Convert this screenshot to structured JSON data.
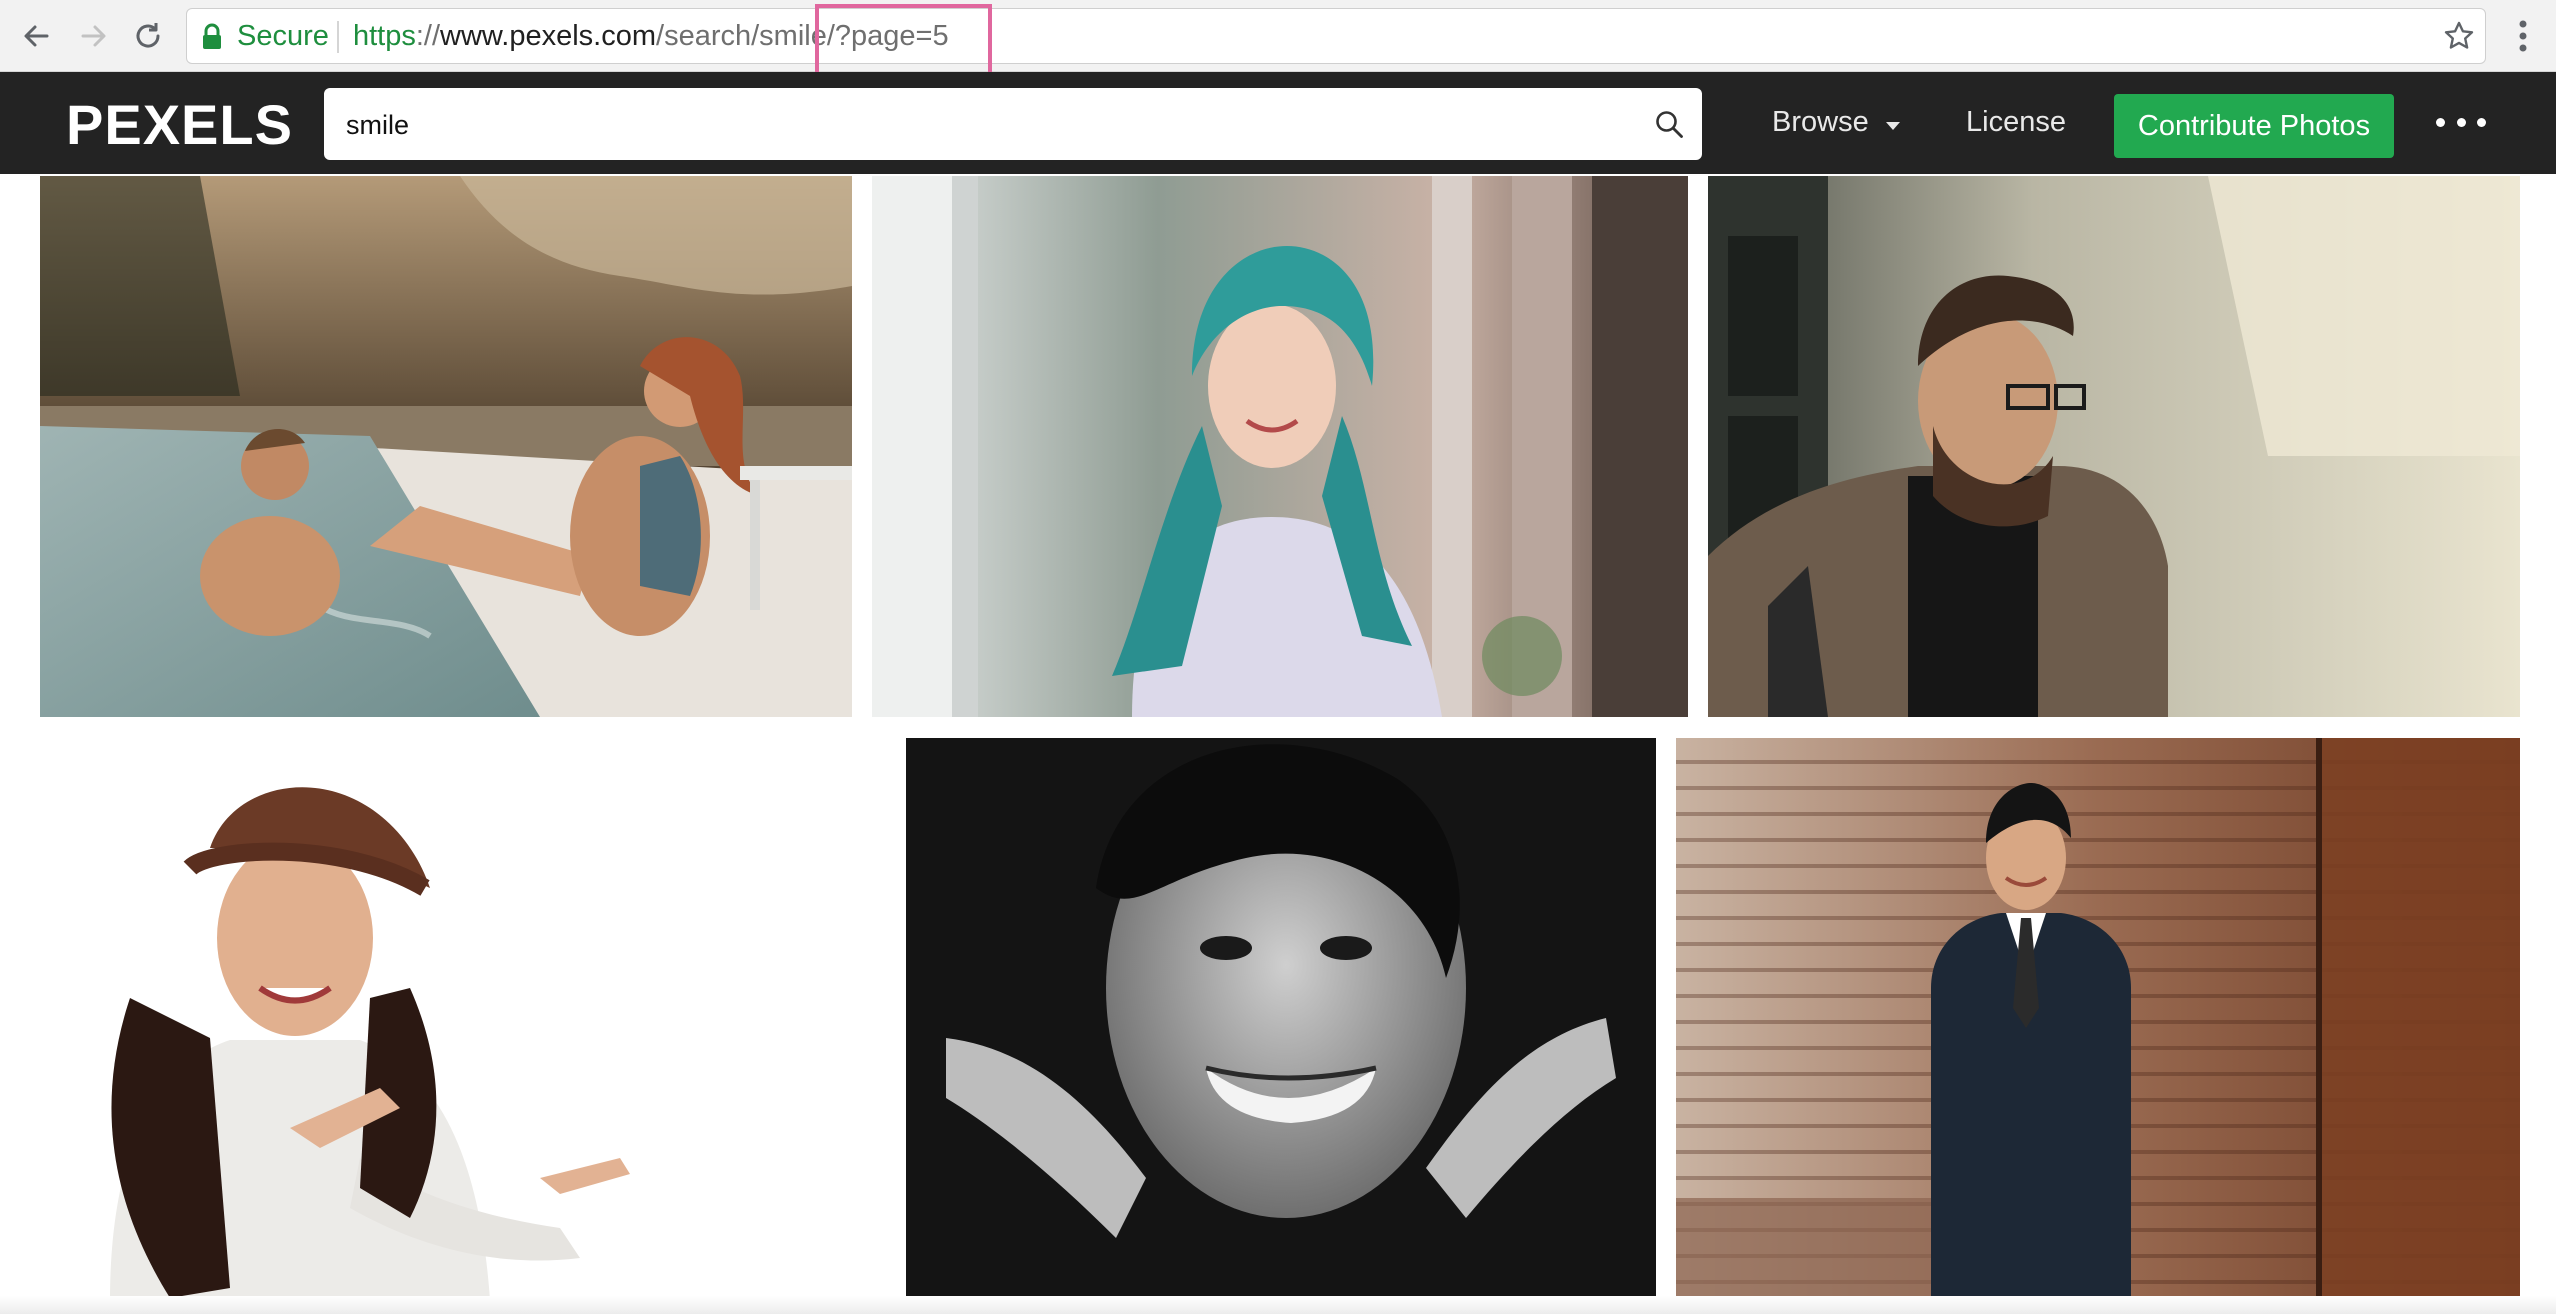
{
  "browser": {
    "secure_label": "Secure",
    "url": {
      "scheme": "https",
      "separator": "://",
      "host": "www.pexels.com",
      "path": "/search/smile/?page=5"
    }
  },
  "header": {
    "logo": "PEXELS",
    "search": {
      "value": "smile"
    },
    "nav": {
      "browse_label": "Browse",
      "license_label": "License",
      "contribute_label": "Contribute Photos"
    }
  },
  "colors": {
    "header_bg": "#232323",
    "contribute_green": "#22a950",
    "secure_green": "#1e8e3e",
    "highlight_pink": "#e0679e"
  }
}
